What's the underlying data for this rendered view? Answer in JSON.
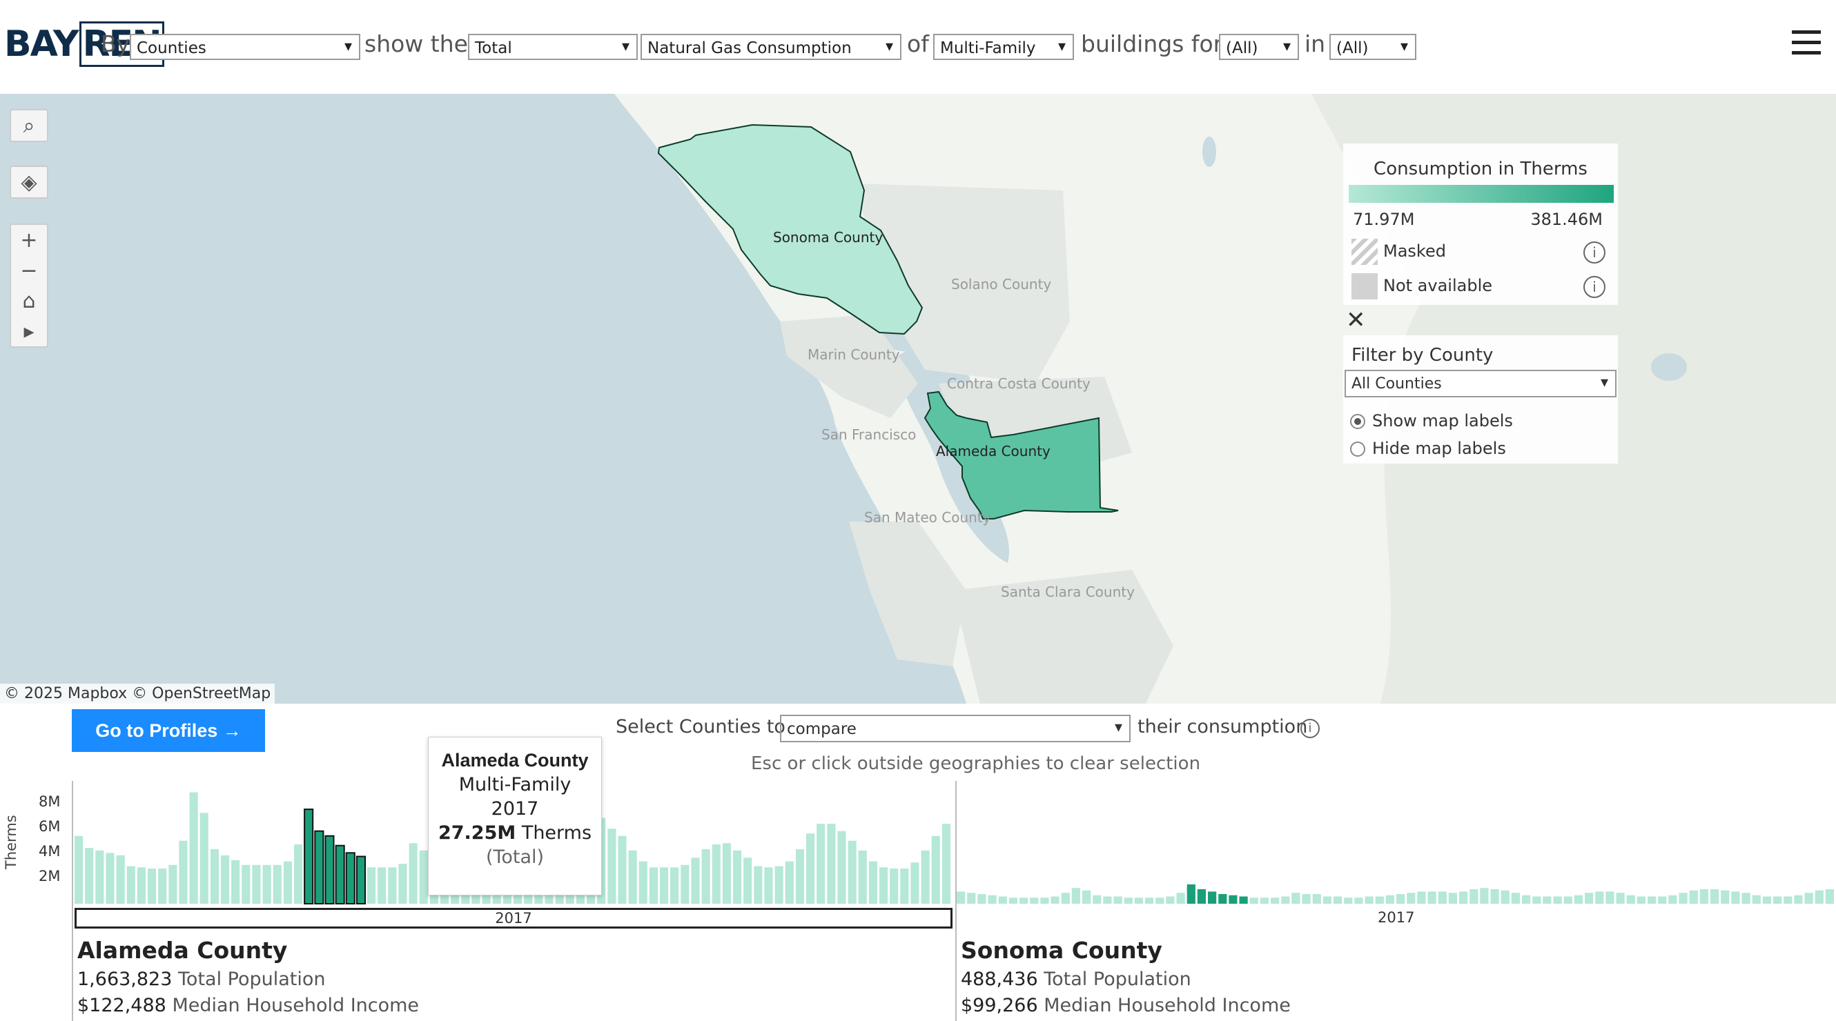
{
  "header": {
    "logo_a": "BAY",
    "logo_b": "REN",
    "w_by": "By",
    "geo_select": "Counties",
    "w_show": "show the",
    "measure_select": "Total",
    "metric_select": "Natural Gas Consumption",
    "w_of": "of",
    "building_select": "Multi-Family",
    "w_buildings": "buildings for",
    "for_select": "(All)",
    "w_in": "in",
    "in_select": "(All)"
  },
  "map": {
    "labels": {
      "sonoma": "Sonoma County",
      "solano": "Solano County",
      "marin": "Marin County",
      "contra_costa": "Contra Costa County",
      "san_francisco": "San Francisco",
      "alameda": "Alameda County",
      "san_mateo": "San Mateo County",
      "santa_clara": "Santa Clara County"
    },
    "attribution": "© 2025 Mapbox  © OpenStreetMap",
    "controls": [
      "search-icon",
      "layers-icon",
      "zoom-in-icon",
      "zoom-out-icon",
      "home-icon",
      "play-icon"
    ]
  },
  "legend": {
    "title": "Consumption in Therms",
    "min": "71.97M",
    "max": "381.46M",
    "masked": "Masked",
    "not_available": "Not available",
    "colors": {
      "low": "#b5e8d6",
      "high": "#1fa57f"
    }
  },
  "filter": {
    "label": "Filter by County",
    "value": "All Counties",
    "show_labels": "Show map labels",
    "hide_labels": "Hide map labels"
  },
  "bottom": {
    "profiles_button": "Go to Profiles →",
    "select_counties": "Select Counties to",
    "compare_select": "compare",
    "their_consumption": "their consumption",
    "esc_hint": "Esc or click outside geographies to clear selection",
    "ylabel": "Therms",
    "yticks": [
      "8M",
      "6M",
      "4M",
      "2M"
    ],
    "year_left": "2017",
    "year_right": "2017"
  },
  "tooltip": {
    "county": "Alameda County",
    "building": "Multi-Family",
    "year": "2017",
    "value": "27.25M",
    "unit": "Therms",
    "measure": "(Total)"
  },
  "counties": [
    {
      "name": "Alameda County",
      "population": "1,663,823",
      "population_label": "Total Population",
      "income": "$122,488",
      "income_label": "Median Household Income"
    },
    {
      "name": "Sonoma County",
      "population": "488,436",
      "population_label": "Total Population",
      "income": "$99,266",
      "income_label": "Median Household Income"
    }
  ],
  "chart_data": [
    {
      "type": "bar",
      "title": "Alameda County",
      "ylabel": "Therms",
      "ylim": [
        0,
        9
      ],
      "unit": "M",
      "highlight_range": [
        22,
        27
      ],
      "values": [
        5.6,
        4.6,
        4.4,
        4.2,
        4.0,
        3.1,
        3.0,
        2.9,
        2.9,
        3.2,
        5.2,
        9.2,
        7.5,
        4.5,
        4.0,
        3.6,
        3.2,
        3.2,
        3.2,
        3.2,
        3.5,
        4.9,
        7.8,
        6.0,
        5.6,
        4.8,
        4.2,
        3.9,
        3.0,
        3.0,
        3.0,
        3.3,
        5.0,
        4.4,
        4.2,
        3.4,
        3.2,
        2.9,
        2.8,
        3.0,
        3.2,
        3.8,
        4.1,
        4.6,
        4.8,
        4.6,
        4.8,
        4.2,
        5.0,
        6.4,
        7.1,
        6.2,
        5.6,
        4.4,
        3.5,
        3.0,
        3.0,
        3.0,
        3.2,
        3.8,
        4.5,
        4.9,
        5.0,
        4.4,
        3.8,
        3.1,
        3.0,
        3.1,
        3.5,
        4.5,
        5.8,
        6.6,
        6.6,
        6.0,
        5.2,
        4.4,
        3.5,
        3.0,
        2.9,
        2.9,
        3.4,
        4.4,
        5.6,
        6.6
      ],
      "color": "#b5e8d6",
      "highlight_color": "#1a9f7a"
    },
    {
      "type": "bar",
      "title": "Sonoma County",
      "ylim": [
        0,
        9
      ],
      "unit": "M",
      "highlight_range": [
        22,
        27
      ],
      "values": [
        1.0,
        0.9,
        0.8,
        0.7,
        0.6,
        0.5,
        0.5,
        0.5,
        0.5,
        0.6,
        0.9,
        1.3,
        1.1,
        0.7,
        0.6,
        0.6,
        0.5,
        0.5,
        0.5,
        0.5,
        0.6,
        0.9,
        1.6,
        1.2,
        1.0,
        0.8,
        0.7,
        0.6,
        0.5,
        0.5,
        0.5,
        0.6,
        0.9,
        0.8,
        0.8,
        0.6,
        0.6,
        0.5,
        0.5,
        0.6,
        0.6,
        0.7,
        0.8,
        0.9,
        1.0,
        1.0,
        1.0,
        0.9,
        1.0,
        1.2,
        1.3,
        1.2,
        1.1,
        0.9,
        0.7,
        0.6,
        0.6,
        0.6,
        0.6,
        0.7,
        0.9,
        1.0,
        1.0,
        0.9,
        0.7,
        0.6,
        0.6,
        0.6,
        0.7,
        0.9,
        1.1,
        1.2,
        1.2,
        1.1,
        1.0,
        0.9,
        0.7,
        0.6,
        0.6,
        0.6,
        0.7,
        0.9,
        1.1,
        1.2
      ],
      "color": "#b5e8d6",
      "highlight_color": "#1a9f7a"
    }
  ]
}
